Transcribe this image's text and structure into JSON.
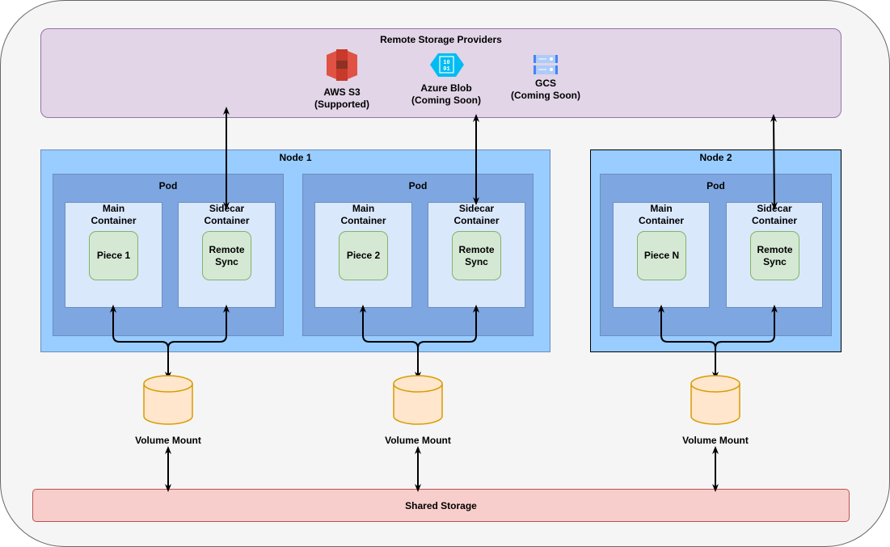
{
  "remote": {
    "title": "Remote Storage Providers",
    "providers": [
      {
        "name": "AWS S3",
        "status": "(Supported)",
        "icon": "aws-s3-icon"
      },
      {
        "name": "Azure Blob",
        "status": "(Coming Soon)",
        "icon": "azure-blob-icon",
        "icon_text": "10\n01"
      },
      {
        "name": "GCS",
        "status": "(Coming Soon)",
        "icon": "gcs-icon"
      }
    ]
  },
  "nodes": [
    {
      "title": "Node 1"
    },
    {
      "title": "Node 2"
    }
  ],
  "pod_label": "Pod",
  "main_container": "Main Container",
  "sidecar_container": "Sidecar Container",
  "pieces": [
    "Piece 1",
    "Piece 2",
    "Piece N"
  ],
  "remote_sync": "Remote Sync",
  "volume_mount": "Volume Mount",
  "shared_storage": "Shared Storage",
  "colors": {
    "remote": "#e1d5e7",
    "node": "#99ccff",
    "pod": "#7ea6e0",
    "container": "#dae8fc",
    "piece": "#d5e8d4",
    "volume": "#ffe6cc",
    "shared": "#f8cecc"
  }
}
